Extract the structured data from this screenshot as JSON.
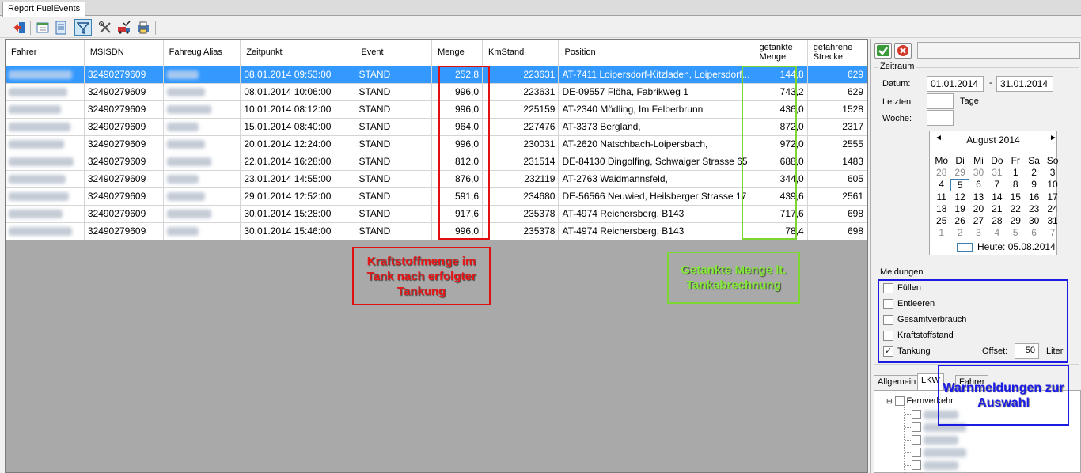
{
  "window": {
    "tab_title": "Report FuelEvents"
  },
  "toolbar": {
    "icons": [
      "exit-icon",
      "export-icon",
      "report-icon",
      "filter-icon",
      "tools-icon",
      "truck-edit-icon",
      "print-icon"
    ]
  },
  "grid": {
    "columns": [
      "Fahrer",
      "MSISDN",
      "Fahreug Alias",
      "Zeitpunkt",
      "Event",
      "Menge",
      "KmStand",
      "Position",
      "getankte Menge",
      "gefahrene Strecke"
    ],
    "rows": [
      {
        "msisdn": "32490279609",
        "zeitpunkt": "08.01.2014 09:53:00",
        "event": "STAND",
        "menge": "252,8",
        "kmstand": "223631",
        "position": "AT-7411 Loipersdorf-Kitzladen, Loipersdorf...",
        "getankt": "144,8",
        "strecke": "629"
      },
      {
        "msisdn": "32490279609",
        "zeitpunkt": "08.01.2014 10:06:00",
        "event": "STAND",
        "menge": "996,0",
        "kmstand": "223631",
        "position": "DE-09557 Flöha, Fabrikweg 1",
        "getankt": "743,2",
        "strecke": "629"
      },
      {
        "msisdn": "32490279609",
        "zeitpunkt": "10.01.2014 08:12:00",
        "event": "STAND",
        "menge": "996,0",
        "kmstand": "225159",
        "position": "AT-2340 Mödling, Im Felberbrunn",
        "getankt": "436,0",
        "strecke": "1528"
      },
      {
        "msisdn": "32490279609",
        "zeitpunkt": "15.01.2014 08:40:00",
        "event": "STAND",
        "menge": "964,0",
        "kmstand": "227476",
        "position": "AT-3373 Bergland,",
        "getankt": "872,0",
        "strecke": "2317"
      },
      {
        "msisdn": "32490279609",
        "zeitpunkt": "20.01.2014 12:24:00",
        "event": "STAND",
        "menge": "996,0",
        "kmstand": "230031",
        "position": "AT-2620 Natschbach-Loipersbach,",
        "getankt": "972,0",
        "strecke": "2555"
      },
      {
        "msisdn": "32490279609",
        "zeitpunkt": "22.01.2014 16:28:00",
        "event": "STAND",
        "menge": "812,0",
        "kmstand": "231514",
        "position": "DE-84130 Dingolfing, Schwaiger Strasse 65",
        "getankt": "688,0",
        "strecke": "1483"
      },
      {
        "msisdn": "32490279609",
        "zeitpunkt": "23.01.2014 14:55:00",
        "event": "STAND",
        "menge": "876,0",
        "kmstand": "232119",
        "position": "AT-2763 Waidmannsfeld,",
        "getankt": "344,0",
        "strecke": "605"
      },
      {
        "msisdn": "32490279609",
        "zeitpunkt": "29.01.2014 12:52:00",
        "event": "STAND",
        "menge": "591,6",
        "kmstand": "234680",
        "position": "DE-56566 Neuwied, Heilsberger Strasse 17",
        "getankt": "439,6",
        "strecke": "2561"
      },
      {
        "msisdn": "32490279609",
        "zeitpunkt": "30.01.2014 15:28:00",
        "event": "STAND",
        "menge": "917,6",
        "kmstand": "235378",
        "position": "AT-4974 Reichersberg, B143",
        "getankt": "717,6",
        "strecke": "698"
      },
      {
        "msisdn": "32490279609",
        "zeitpunkt": "30.01.2014 15:46:00",
        "event": "STAND",
        "menge": "996,0",
        "kmstand": "235378",
        "position": "AT-4974 Reichersberg, B143",
        "getankt": "78,4",
        "strecke": "698"
      }
    ]
  },
  "annotations": {
    "menge": "Kraftstoffmenge im Tank nach erfolgter Tankung",
    "getankt": "Getankte Menge lt. Tankabrechnung",
    "meldungen": "Warnmeldungen zur Auswahl"
  },
  "zeitraum": {
    "title": "Zeitraum",
    "datum_label": "Datum:",
    "date_from": "01.01.2014",
    "date_sep": "-",
    "date_to": "31.01.2014",
    "letzten_label": "Letzten:",
    "tage_label": "Tage",
    "woche_label": "Woche:",
    "calendar": {
      "month": "August 2014",
      "prev": "◄",
      "next": "►",
      "weekdays": [
        "Mo",
        "Di",
        "Mi",
        "Do",
        "Fr",
        "Sa",
        "So"
      ],
      "days": [
        {
          "d": "28",
          "o": true
        },
        {
          "d": "29",
          "o": true
        },
        {
          "d": "30",
          "o": true
        },
        {
          "d": "31",
          "o": true
        },
        {
          "d": "1"
        },
        {
          "d": "2"
        },
        {
          "d": "3"
        },
        {
          "d": "4"
        },
        {
          "d": "5",
          "t": true
        },
        {
          "d": "6"
        },
        {
          "d": "7"
        },
        {
          "d": "8"
        },
        {
          "d": "9"
        },
        {
          "d": "10"
        },
        {
          "d": "11"
        },
        {
          "d": "12"
        },
        {
          "d": "13"
        },
        {
          "d": "14"
        },
        {
          "d": "15"
        },
        {
          "d": "16"
        },
        {
          "d": "17"
        },
        {
          "d": "18"
        },
        {
          "d": "19"
        },
        {
          "d": "20"
        },
        {
          "d": "21"
        },
        {
          "d": "22"
        },
        {
          "d": "23"
        },
        {
          "d": "24"
        },
        {
          "d": "25"
        },
        {
          "d": "26"
        },
        {
          "d": "27"
        },
        {
          "d": "28"
        },
        {
          "d": "29"
        },
        {
          "d": "30"
        },
        {
          "d": "31"
        },
        {
          "d": "1",
          "o": true
        },
        {
          "d": "2",
          "o": true
        },
        {
          "d": "3",
          "o": true
        },
        {
          "d": "4",
          "o": true
        },
        {
          "d": "5",
          "o": true
        },
        {
          "d": "6",
          "o": true
        },
        {
          "d": "7",
          "o": true
        }
      ],
      "today_label": "Heute: 05.08.2014"
    }
  },
  "meldungen": {
    "title": "Meldungen",
    "items": [
      {
        "label": "Füllen",
        "checked": false
      },
      {
        "label": "Entleeren",
        "checked": false
      },
      {
        "label": "Gesamtverbrauch",
        "checked": false
      },
      {
        "label": "Kraftstoffstand",
        "checked": false
      },
      {
        "label": "Tankung",
        "checked": true
      }
    ],
    "offset_label": "Offset:",
    "offset_value": "50",
    "unit": "Liter"
  },
  "lower_tabs": [
    "Allgemein",
    "LKW",
    "Fahrer"
  ],
  "tree": {
    "root": "Fernverkehr"
  }
}
